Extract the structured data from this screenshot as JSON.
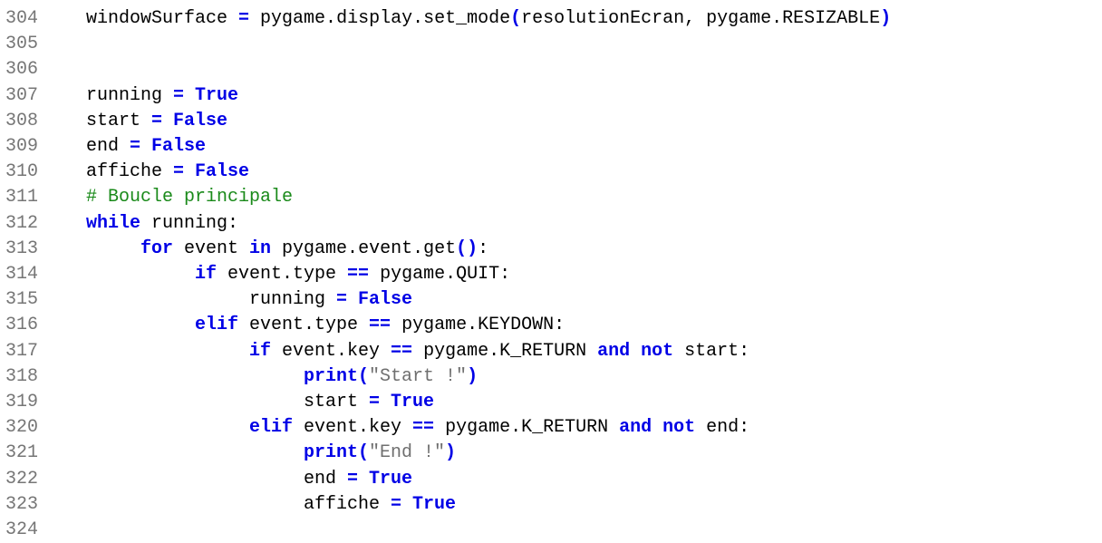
{
  "editor": {
    "lines": [
      {
        "number": "304",
        "indent": 0,
        "tokens": [
          {
            "type": "plain",
            "text": "windowSurface "
          },
          {
            "type": "op",
            "text": "="
          },
          {
            "type": "plain",
            "text": " pygame.display.set_mode"
          },
          {
            "type": "op",
            "text": "("
          },
          {
            "type": "plain",
            "text": "resolutionEcran, pygame.RESIZABLE"
          },
          {
            "type": "op",
            "text": ")"
          }
        ]
      },
      {
        "number": "305",
        "indent": 0,
        "tokens": []
      },
      {
        "number": "306",
        "indent": 0,
        "tokens": []
      },
      {
        "number": "307",
        "indent": 0,
        "tokens": [
          {
            "type": "plain",
            "text": "running "
          },
          {
            "type": "op",
            "text": "="
          },
          {
            "type": "plain",
            "text": " "
          },
          {
            "type": "kw",
            "text": "True"
          }
        ]
      },
      {
        "number": "308",
        "indent": 0,
        "tokens": [
          {
            "type": "plain",
            "text": "start "
          },
          {
            "type": "op",
            "text": "="
          },
          {
            "type": "plain",
            "text": " "
          },
          {
            "type": "kw",
            "text": "False"
          }
        ]
      },
      {
        "number": "309",
        "indent": 0,
        "tokens": [
          {
            "type": "plain",
            "text": "end "
          },
          {
            "type": "op",
            "text": "="
          },
          {
            "type": "plain",
            "text": " "
          },
          {
            "type": "kw",
            "text": "False"
          }
        ]
      },
      {
        "number": "310",
        "indent": 0,
        "tokens": [
          {
            "type": "plain",
            "text": "affiche "
          },
          {
            "type": "op",
            "text": "="
          },
          {
            "type": "plain",
            "text": " "
          },
          {
            "type": "kw",
            "text": "False"
          }
        ]
      },
      {
        "number": "311",
        "indent": 0,
        "tokens": [
          {
            "type": "comment",
            "text": "# Boucle principale"
          }
        ]
      },
      {
        "number": "312",
        "indent": 0,
        "tokens": [
          {
            "type": "kw",
            "text": "while"
          },
          {
            "type": "plain",
            "text": " running:"
          }
        ]
      },
      {
        "number": "313",
        "indent": 1,
        "tokens": [
          {
            "type": "kw",
            "text": "for"
          },
          {
            "type": "plain",
            "text": " event "
          },
          {
            "type": "kw",
            "text": "in"
          },
          {
            "type": "plain",
            "text": " pygame.event.get"
          },
          {
            "type": "op",
            "text": "()"
          },
          {
            "type": "plain",
            "text": ":"
          }
        ]
      },
      {
        "number": "314",
        "indent": 2,
        "tokens": [
          {
            "type": "kw",
            "text": "if"
          },
          {
            "type": "plain",
            "text": " event.type "
          },
          {
            "type": "op",
            "text": "=="
          },
          {
            "type": "plain",
            "text": " pygame.QUIT:"
          }
        ]
      },
      {
        "number": "315",
        "indent": 3,
        "tokens": [
          {
            "type": "plain",
            "text": "running "
          },
          {
            "type": "op",
            "text": "="
          },
          {
            "type": "plain",
            "text": " "
          },
          {
            "type": "kw",
            "text": "False"
          }
        ]
      },
      {
        "number": "316",
        "indent": 2,
        "tokens": [
          {
            "type": "kw",
            "text": "elif"
          },
          {
            "type": "plain",
            "text": " event.type "
          },
          {
            "type": "op",
            "text": "=="
          },
          {
            "type": "plain",
            "text": " pygame.KEYDOWN:"
          }
        ]
      },
      {
        "number": "317",
        "indent": 3,
        "tokens": [
          {
            "type": "kw",
            "text": "if"
          },
          {
            "type": "plain",
            "text": " event.key "
          },
          {
            "type": "op",
            "text": "=="
          },
          {
            "type": "plain",
            "text": " pygame.K_RETURN "
          },
          {
            "type": "kw",
            "text": "and"
          },
          {
            "type": "plain",
            "text": " "
          },
          {
            "type": "kw",
            "text": "not"
          },
          {
            "type": "plain",
            "text": " start:"
          }
        ]
      },
      {
        "number": "318",
        "indent": 4,
        "tokens": [
          {
            "type": "kw",
            "text": "print"
          },
          {
            "type": "op",
            "text": "("
          },
          {
            "type": "str",
            "text": "\"Start !\""
          },
          {
            "type": "op",
            "text": ")"
          }
        ]
      },
      {
        "number": "319",
        "indent": 4,
        "tokens": [
          {
            "type": "plain",
            "text": "start "
          },
          {
            "type": "op",
            "text": "="
          },
          {
            "type": "plain",
            "text": " "
          },
          {
            "type": "kw",
            "text": "True"
          }
        ]
      },
      {
        "number": "320",
        "indent": 3,
        "tokens": [
          {
            "type": "kw",
            "text": "elif"
          },
          {
            "type": "plain",
            "text": " event.key "
          },
          {
            "type": "op",
            "text": "=="
          },
          {
            "type": "plain",
            "text": " pygame.K_RETURN "
          },
          {
            "type": "kw",
            "text": "and"
          },
          {
            "type": "plain",
            "text": " "
          },
          {
            "type": "kw",
            "text": "not"
          },
          {
            "type": "plain",
            "text": " end:"
          }
        ]
      },
      {
        "number": "321",
        "indent": 4,
        "tokens": [
          {
            "type": "kw",
            "text": "print"
          },
          {
            "type": "op",
            "text": "("
          },
          {
            "type": "str",
            "text": "\"End !\""
          },
          {
            "type": "op",
            "text": ")"
          }
        ]
      },
      {
        "number": "322",
        "indent": 4,
        "tokens": [
          {
            "type": "plain",
            "text": "end "
          },
          {
            "type": "op",
            "text": "="
          },
          {
            "type": "plain",
            "text": " "
          },
          {
            "type": "kw",
            "text": "True"
          }
        ]
      },
      {
        "number": "323",
        "indent": 4,
        "tokens": [
          {
            "type": "plain",
            "text": "affiche "
          },
          {
            "type": "op",
            "text": "="
          },
          {
            "type": "plain",
            "text": " "
          },
          {
            "type": "kw",
            "text": "True"
          }
        ]
      },
      {
        "number": "324",
        "indent": 0,
        "tokens": []
      }
    ],
    "colors": {
      "keyword": "#0000e6",
      "operator": "#0000e6",
      "string": "#6f6f6f",
      "comment": "#1a8a1a",
      "line_number": "#767676",
      "text": "#000000",
      "background": "#ffffff"
    }
  }
}
